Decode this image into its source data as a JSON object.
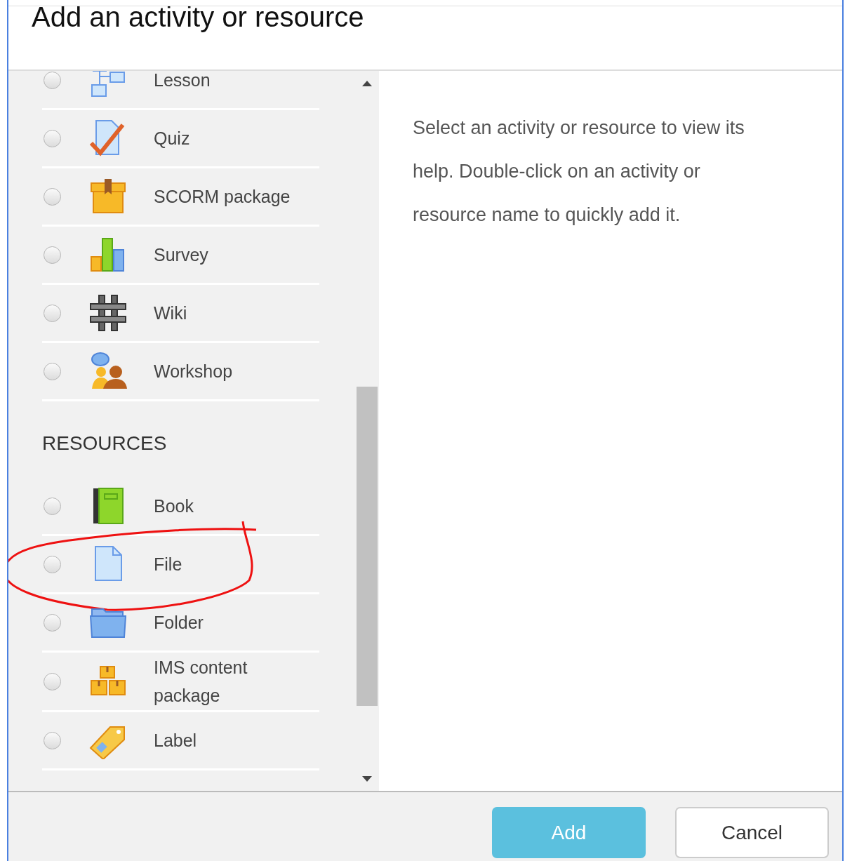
{
  "dialog": {
    "title": "Add an activity or resource"
  },
  "list": [
    {
      "kind": "item",
      "label": "Lesson",
      "selected": false,
      "circled": false
    },
    {
      "kind": "item",
      "label": "Quiz",
      "selected": false,
      "circled": false
    },
    {
      "kind": "item",
      "label": "SCORM package",
      "selected": false,
      "circled": false
    },
    {
      "kind": "item",
      "label": "Survey",
      "selected": false,
      "circled": false
    },
    {
      "kind": "item",
      "label": "Wiki",
      "selected": false,
      "circled": false
    },
    {
      "kind": "item",
      "label": "Workshop",
      "selected": false,
      "circled": false
    },
    {
      "kind": "heading",
      "text": "RESOURCES"
    },
    {
      "kind": "item",
      "label": "Book",
      "selected": false,
      "circled": false
    },
    {
      "kind": "item",
      "label": "File",
      "selected": false,
      "circled": true
    },
    {
      "kind": "item",
      "label": "Folder",
      "selected": false,
      "circled": false
    },
    {
      "kind": "item",
      "label": "IMS content package",
      "selected": false,
      "circled": false
    },
    {
      "kind": "item",
      "label": "Label",
      "selected": false,
      "circled": false
    }
  ],
  "help": "Select an activity or resource to view its help. Double-click on an activity or resource name to quickly add it.",
  "buttons": [
    {
      "label": "Add",
      "kind": "primary"
    },
    {
      "label": "Cancel",
      "kind": "secondary"
    }
  ]
}
